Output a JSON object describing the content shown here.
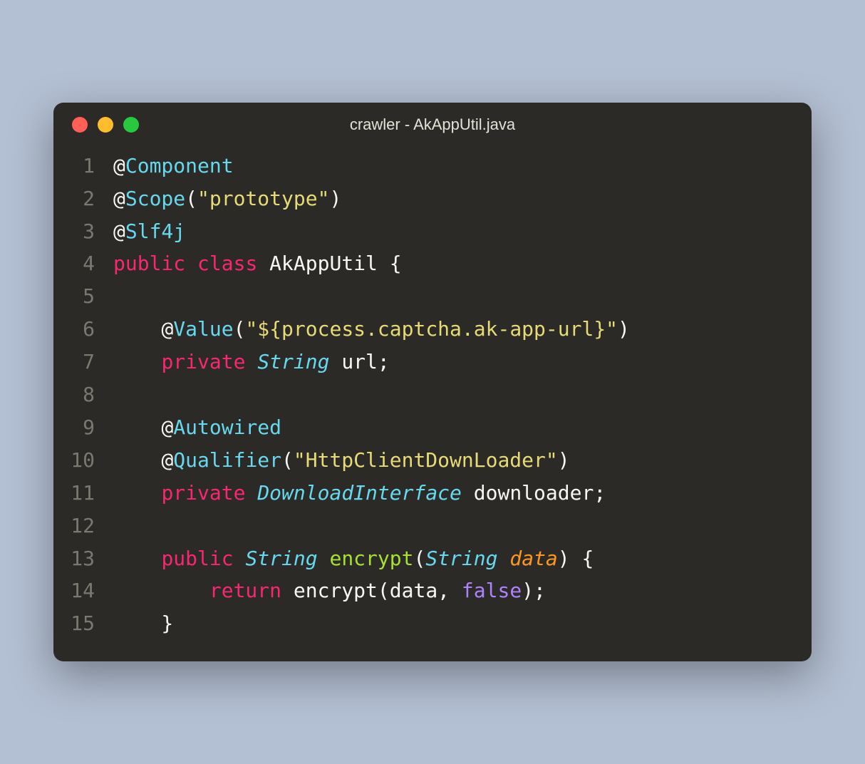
{
  "window": {
    "title": "crawler - AkAppUtil.java"
  },
  "traffic_lights": {
    "red": "#ff5f56",
    "yellow": "#ffbd2e",
    "green": "#27c93f"
  },
  "code": {
    "lines": [
      {
        "n": "1",
        "tokens": [
          {
            "t": "@",
            "c": "tk-at"
          },
          {
            "t": "Component",
            "c": "tk-ann"
          }
        ]
      },
      {
        "n": "2",
        "tokens": [
          {
            "t": "@",
            "c": "tk-at"
          },
          {
            "t": "Scope",
            "c": "tk-ann"
          },
          {
            "t": "(",
            "c": "tk-punct"
          },
          {
            "t": "\"prototype\"",
            "c": "tk-str"
          },
          {
            "t": ")",
            "c": "tk-punct"
          }
        ]
      },
      {
        "n": "3",
        "tokens": [
          {
            "t": "@",
            "c": "tk-at"
          },
          {
            "t": "Slf4j",
            "c": "tk-ann"
          }
        ]
      },
      {
        "n": "4",
        "tokens": [
          {
            "t": "public",
            "c": "tk-kw"
          },
          {
            "t": " ",
            "c": ""
          },
          {
            "t": "class",
            "c": "tk-kw"
          },
          {
            "t": " ",
            "c": ""
          },
          {
            "t": "AkAppUtil",
            "c": "tk-name"
          },
          {
            "t": " {",
            "c": "tk-punct"
          }
        ]
      },
      {
        "n": "5",
        "tokens": [
          {
            "t": "",
            "c": ""
          }
        ]
      },
      {
        "n": "6",
        "tokens": [
          {
            "t": "    ",
            "c": ""
          },
          {
            "t": "@",
            "c": "tk-at"
          },
          {
            "t": "Value",
            "c": "tk-ann"
          },
          {
            "t": "(",
            "c": "tk-punct"
          },
          {
            "t": "\"${process.captcha.ak-app-url}\"",
            "c": "tk-str"
          },
          {
            "t": ")",
            "c": "tk-punct"
          }
        ]
      },
      {
        "n": "7",
        "tokens": [
          {
            "t": "    ",
            "c": ""
          },
          {
            "t": "private",
            "c": "tk-kw"
          },
          {
            "t": " ",
            "c": ""
          },
          {
            "t": "String",
            "c": "tk-type"
          },
          {
            "t": " ",
            "c": ""
          },
          {
            "t": "url;",
            "c": "tk-name"
          }
        ]
      },
      {
        "n": "8",
        "tokens": [
          {
            "t": "",
            "c": ""
          }
        ]
      },
      {
        "n": "9",
        "tokens": [
          {
            "t": "    ",
            "c": ""
          },
          {
            "t": "@",
            "c": "tk-at"
          },
          {
            "t": "Autowired",
            "c": "tk-ann"
          }
        ]
      },
      {
        "n": "10",
        "tokens": [
          {
            "t": "    ",
            "c": ""
          },
          {
            "t": "@",
            "c": "tk-at"
          },
          {
            "t": "Qualifier",
            "c": "tk-ann"
          },
          {
            "t": "(",
            "c": "tk-punct"
          },
          {
            "t": "\"HttpClientDownLoader\"",
            "c": "tk-str"
          },
          {
            "t": ")",
            "c": "tk-punct"
          }
        ]
      },
      {
        "n": "11",
        "tokens": [
          {
            "t": "    ",
            "c": ""
          },
          {
            "t": "private",
            "c": "tk-kw"
          },
          {
            "t": " ",
            "c": ""
          },
          {
            "t": "DownloadInterface",
            "c": "tk-type"
          },
          {
            "t": " ",
            "c": ""
          },
          {
            "t": "downloader;",
            "c": "tk-name"
          }
        ]
      },
      {
        "n": "12",
        "tokens": [
          {
            "t": "",
            "c": ""
          }
        ]
      },
      {
        "n": "13",
        "tokens": [
          {
            "t": "    ",
            "c": ""
          },
          {
            "t": "public",
            "c": "tk-kw"
          },
          {
            "t": " ",
            "c": ""
          },
          {
            "t": "String",
            "c": "tk-type"
          },
          {
            "t": " ",
            "c": ""
          },
          {
            "t": "encrypt",
            "c": "tk-method"
          },
          {
            "t": "(",
            "c": "tk-punct"
          },
          {
            "t": "String",
            "c": "tk-type"
          },
          {
            "t": " ",
            "c": ""
          },
          {
            "t": "data",
            "c": "tk-param"
          },
          {
            "t": ") {",
            "c": "tk-punct"
          }
        ]
      },
      {
        "n": "14",
        "tokens": [
          {
            "t": "        ",
            "c": ""
          },
          {
            "t": "return",
            "c": "tk-return"
          },
          {
            "t": " ",
            "c": ""
          },
          {
            "t": "encrypt",
            "c": "tk-name"
          },
          {
            "t": "(data, ",
            "c": "tk-punct"
          },
          {
            "t": "false",
            "c": "tk-const"
          },
          {
            "t": ");",
            "c": "tk-punct"
          }
        ]
      },
      {
        "n": "15",
        "tokens": [
          {
            "t": "    }",
            "c": "tk-punct"
          }
        ]
      }
    ]
  }
}
